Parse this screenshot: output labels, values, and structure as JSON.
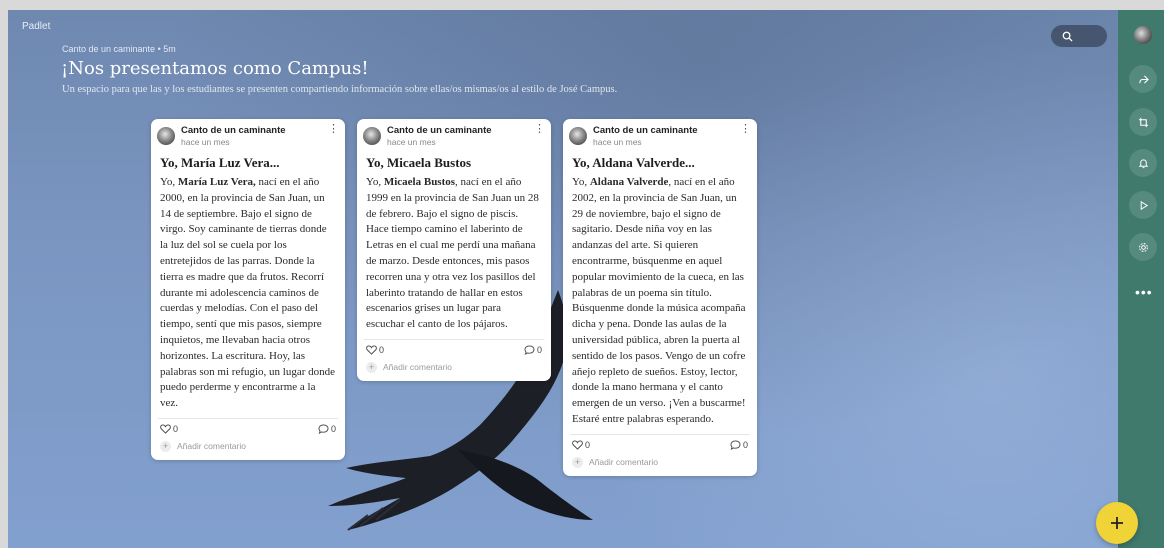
{
  "brand": "Padlet",
  "header": {
    "meta": "Canto de un caminante • 5m",
    "title": "¡Nos presentamos como Campus!",
    "subtitle": "Un espacio para que las y los estudiantes se presenten compartiendo información sobre ellas/os mismas/os al estilo de José Campus."
  },
  "colors": {
    "rail": "#3f7a6d",
    "fab": "#f0d437",
    "background": "#7a95c0"
  },
  "posts": [
    {
      "author": "Canto de un caminante",
      "time": "hace un mes",
      "title": "Yo, María Luz Vera...",
      "body_pre": "Yo, ",
      "body_bold": "María Luz Vera,",
      "body_post": " nací en el año 2000, en la provincia de San Juan, un 14 de septiembre. Bajo el signo de virgo. Soy caminante de tierras donde la luz del sol se cuela por los entretejidos de las parras. Donde la tierra es madre que da frutos. Recorrí durante mi adolescencia caminos de cuerdas y melodías. Con el paso del tiempo, sentí que mis pasos, siempre inquietos, me llevaban hacia otros horizontes. La escritura. Hoy, las palabras son mi refugio, un lugar donde puedo perderme y encontrarme a la vez.",
      "likes": "0",
      "comments": "0",
      "add_comment": "Añadir comentario"
    },
    {
      "author": "Canto de un caminante",
      "time": "hace un mes",
      "title": "Yo, Micaela Bustos",
      "body_pre": "Yo, ",
      "body_bold": "Micaela Bustos",
      "body_post": ", nací en el año 1999 en la provincia de San Juan un 28 de febrero. Bajo el signo de piscis. Hace tiempo camino el laberinto de Letras en el cual me perdí una mañana de marzo. Desde entonces, mis pasos recorren una y otra vez los pasillos del laberinto tratando de hallar en estos escenarios grises un lugar para escuchar el canto de los pájaros.",
      "likes": "0",
      "comments": "0",
      "add_comment": "Añadir comentario"
    },
    {
      "author": "Canto de un caminante",
      "time": "hace un mes",
      "title": "Yo, Aldana Valverde...",
      "body_pre": "Yo, ",
      "body_bold": "Aldana Valverde",
      "body_post": ", nací en el año 2002, en la provincia de San Juan, un 29 de noviembre, bajo el signo de sagitario. Desde niña voy en las andanzas del arte. Si quieren encontrarme, búsquenme en aquel popular movimiento de la cueca, en las palabras de un poema sin título. Búsquenme donde la música acompaña dicha y pena. Donde las aulas de la universidad pública, abren la puerta al sentido de los pasos. Vengo de un cofre añejo repleto de sueños. Estoy, lector, donde la mano hermana y el canto emergen de un verso. ¡Ven a buscarme!",
      "body_last": "Estaré entre palabras esperando.",
      "likes": "0",
      "comments": "0",
      "add_comment": "Añadir comentario"
    }
  ],
  "rail": {
    "icons": [
      "avatar",
      "share-icon",
      "remix-icon",
      "bell-icon",
      "play-icon",
      "settings-icon",
      "more-icon"
    ],
    "more": "•••"
  },
  "fab": {
    "label": "+"
  }
}
